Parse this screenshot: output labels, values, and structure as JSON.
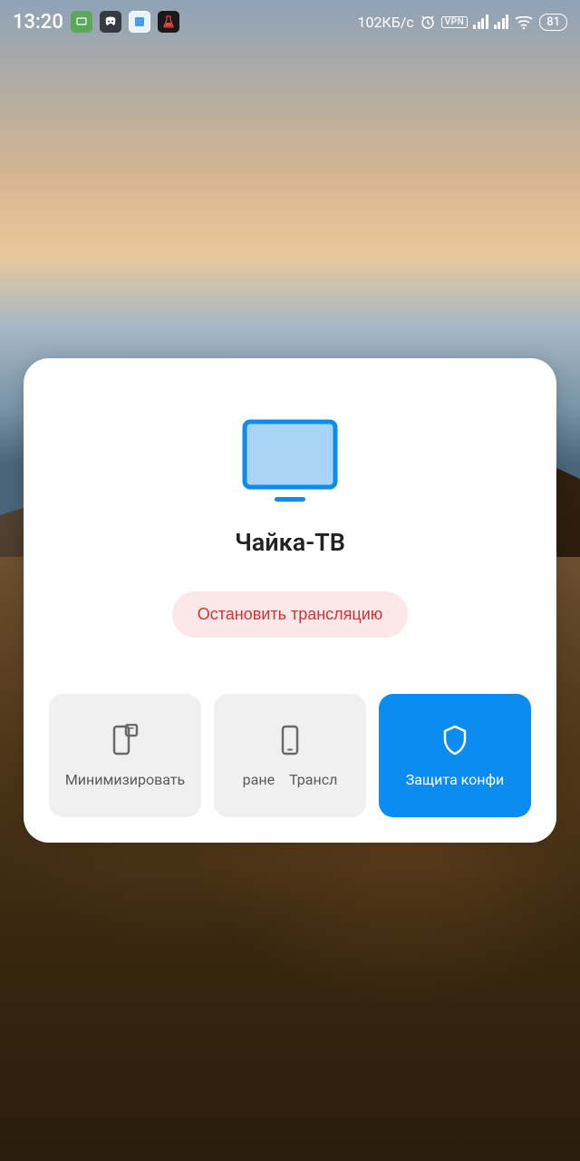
{
  "statusBar": {
    "time": "13:20",
    "netSpeed": "102КБ/с",
    "vpnLabel": "VPN",
    "battery": "81",
    "icons": {
      "app1": "streamer-app-icon",
      "app2": "discord-icon",
      "app3": "notes-app-icon",
      "app4": "beaker-icon",
      "alarm": "alarm-icon",
      "signal1": "signal-bars-4",
      "signal2": "signal-bars-4",
      "wifi": "wifi-icon"
    }
  },
  "card": {
    "deviceName": "Чайка-ТВ",
    "stopButtonLabel": "Остановить трансляцию",
    "options": {
      "minimize": {
        "label": "Минимизировать",
        "icon": "minimize-phone-icon"
      },
      "middle": {
        "labelLeft": "ране",
        "labelRight": "Трансл",
        "icon": "phone-icon"
      },
      "privacy": {
        "label": "Защита конфи",
        "icon": "shield-icon"
      }
    }
  }
}
